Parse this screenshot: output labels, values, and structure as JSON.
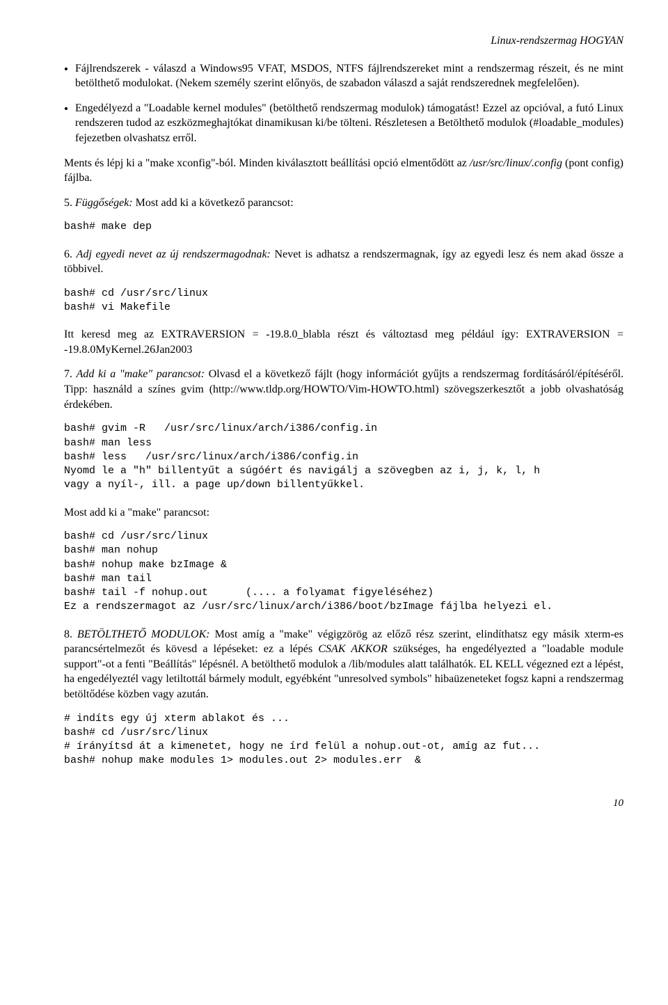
{
  "header": "Linux-rendszermag HOGYAN",
  "bullet1": "Fájlrendszerek - válaszd a Windows95 VFAT, MSDOS, NTFS fájlrendszereket mint a rendszermag részeit, és ne mint betölthető modulokat. (Nekem személy szerint előnyös, de szabadon válaszd a saját rendszerednek megfelelően).",
  "bullet2": "Engedélyezd a \"Loadable kernel modules\" (betölthető rendszermag modulok) támogatást! Ezzel az opcióval, a futó Linux rendszeren tudod az eszközmeghajtókat dinamikusan ki/be tölteni. Részletesen a Betölthető modulok (#loadable_modules) fejezetben olvashatsz erről.",
  "para_ments_a": "Ments és lépj ki a \"make xconfig\"-ból. Minden kiválasztott beállítási opció elmentődött az ",
  "para_ments_b": "/usr/src/linux/.config",
  "para_ments_c": " (pont config) fájlba.",
  "step5_a": "5.  ",
  "step5_b": "Függőségek:",
  "step5_c": "  Most add ki a következő parancsot:",
  "code5": "bash# make dep",
  "step6_a": "6.  ",
  "step6_b": "Adj egyedi nevet az új rendszermagodnak:",
  "step6_c": "  Nevet is adhatsz a rendszermagnak, így az egyedi lesz és nem akad össze a többivel.",
  "code6": "bash# cd /usr/src/linux\nbash# vi Makefile",
  "para_extra": "Itt keresd meg az EXTRAVERSION = -19.8.0_blabla részt és változtasd meg például így: EXTRAVERSION = -19.8.0MyKernel.26Jan2003",
  "step7_a": "7.  ",
  "step7_b": "Add ki a \"make\" parancsot:",
  "step7_c": "  Olvasd el a következő fájlt (hogy információt gyűjts a rendszermag fordításáról/építéséről. Tipp: használd a színes  gvim  (http://www.tldp.org/HOWTO/Vim-HOWTO.html) szövegszerkesztőt a jobb olvashatóság érdekében.",
  "code7a": "bash# gvim -R   /usr/src/linux/arch/i386/config.in\nbash# man less\nbash# less   /usr/src/linux/arch/i386/config.in\nNyomd le a \"h\" billentyűt a súgóért és navigálj a szövegben az i, j, k, l, h\nvagy a nyíl-, ill. a page up/down billentyűkkel.",
  "para_most": "Most add ki a \"make\" parancsot:",
  "code7b": "bash# cd /usr/src/linux\nbash# man nohup\nbash# nohup make bzImage &\nbash# man tail\nbash# tail -f nohup.out      (.... a folyamat figyeléséhez)\nEz a rendszermagot az /usr/src/linux/arch/i386/boot/bzImage fájlba helyezi el.",
  "step8_a": "8.  ",
  "step8_b": "BETÖLTHETŐ MODULOK:",
  "step8_c": "  Most amíg a \"make\" végigzörög az előző rész szerint, elindíthatsz egy másik xterm-es parancsértelmezőt és kövesd a lépéseket: ez a lépés  ",
  "step8_d": "CSAK AKKOR",
  "step8_e": "  szükséges, ha engedélyezted a \"loadable module support\"-ot a fenti \"Beállítás\" lépésnél. A betölthető modulok a /lib/modules alatt találhatók. EL KELL végezned ezt a lépést, ha engedélyeztél vagy letiltottál bármely modult, egyébként \"unresolved symbols\" hibaüzeneteket fogsz kapni a rendszermag betöltődése közben vagy azután.",
  "code8": "# indíts egy új xterm ablakot és ...\nbash# cd /usr/src/linux\n# írányítsd át a kimenetet, hogy ne írd felül a nohup.out-ot, amíg az fut...\nbash# nohup make modules 1> modules.out 2> modules.err  &",
  "page": "10"
}
